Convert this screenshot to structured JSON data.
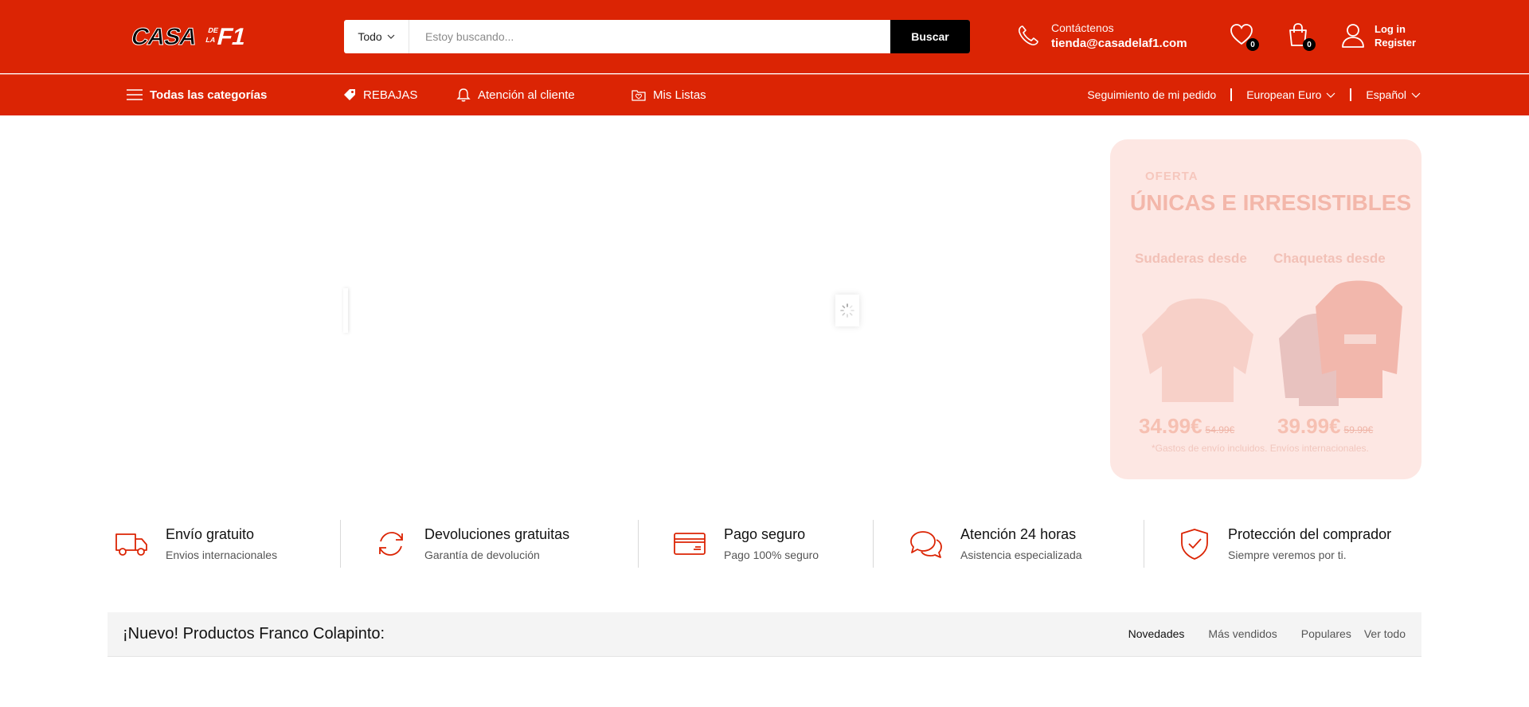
{
  "header": {
    "logo_text": "CASA DE LA F1",
    "search": {
      "category": "Todo",
      "placeholder": "Estoy buscando...",
      "button": "Buscar"
    },
    "contact": {
      "label": "Contáctenos",
      "email": "tienda@casadelaf1.com"
    },
    "wishlist_count": "0",
    "cart_count": "0",
    "account": {
      "login": "Log in",
      "register": "Register"
    }
  },
  "nav": {
    "categories": "Todas las categorías",
    "items": [
      {
        "label": "REBAJAS",
        "icon": "tag-icon"
      },
      {
        "label": "Atención al cliente",
        "icon": "bell-icon"
      },
      {
        "label": "Mis Listas",
        "icon": "folder-heart-icon"
      }
    ],
    "tracking": "Seguimiento de mi pedido",
    "currency": "European Euro",
    "language": "Español"
  },
  "promo": {
    "kicker": "OFERTA",
    "headline": "ÚNICAS E IRRESISTIBLES",
    "left_label": "Sudaderas desde",
    "right_label": "Chaquetas desde",
    "left_price": "34.99€",
    "left_old": "54.99€",
    "right_price": "39.99€",
    "right_old": "59.99€",
    "note": "*Gastos de envío incluidos. Envíos internacionales."
  },
  "features": [
    {
      "title": "Envío gratuito",
      "subtitle": "Envios internacionales",
      "icon": "truck-icon"
    },
    {
      "title": "Devoluciones gratuitas",
      "subtitle": "Garantía de devolución",
      "icon": "refresh-icon"
    },
    {
      "title": "Pago seguro",
      "subtitle": "Pago 100% seguro",
      "icon": "credit-card-icon"
    },
    {
      "title": "Atención 24 horas",
      "subtitle": "Asistencia especializada",
      "icon": "chat-icon"
    },
    {
      "title": "Protección del comprador",
      "subtitle": "Siempre veremos por ti.",
      "icon": "shield-check-icon"
    }
  ],
  "section": {
    "title": "¡Nuevo! Productos Franco Colapinto:",
    "tabs": [
      "Novedades",
      "Más vendidos",
      "Populares",
      "Ver todo"
    ]
  },
  "colors": {
    "brand_red": "#db2404",
    "black": "#000000"
  }
}
